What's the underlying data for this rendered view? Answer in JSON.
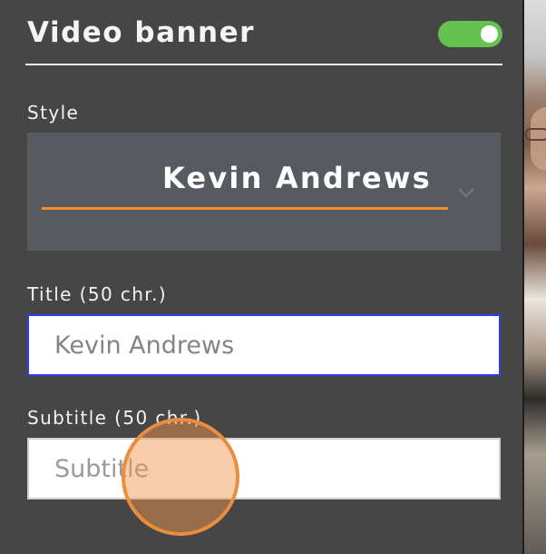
{
  "panel": {
    "title": "Video banner",
    "toggle_state": "on"
  },
  "style": {
    "label": "Style",
    "value": "Kevin Andrews",
    "dropdown_icon": "chevron-down-icon",
    "accent_color": "#f08f2c"
  },
  "title_field": {
    "label": "Title (50 chr.)",
    "value": "Kevin Andrews"
  },
  "subtitle_field": {
    "label": "Subtitle (50 chr.)",
    "placeholder": "Subtitle"
  },
  "theme": {
    "panel_bg": "#464646",
    "style_box_bg": "#575a61",
    "toggle_color": "#64c24f",
    "title_border": "#2f3cf0",
    "cursor_highlight": "#eb8d3e"
  }
}
